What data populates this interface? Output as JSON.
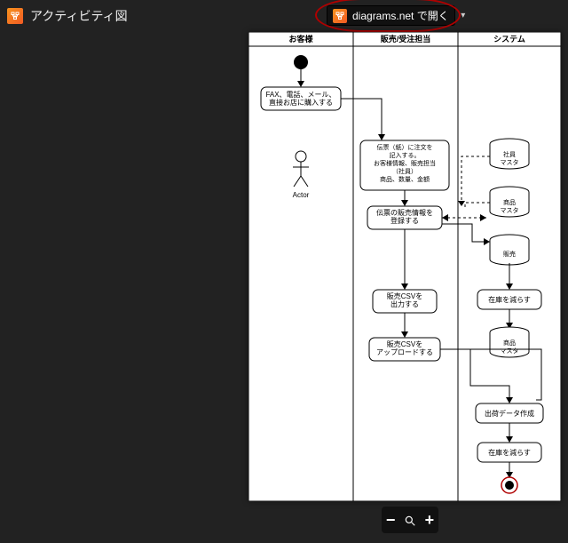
{
  "header": {
    "title": "アクティビティ図",
    "open_label": "diagrams.net で開く"
  },
  "zoom": {
    "minus": "−",
    "plus": "+"
  },
  "diagram": {
    "lanes": [
      "お客様",
      "販売/受注担当",
      "システム"
    ],
    "actor_label": "Actor",
    "nodes": {
      "customer_action": "FAX、電話、メール、\n直接お店に購入する",
      "fill_slip": "伝票（紙）に注文を\n記入する。\nお客様情報、販売担当\n（社員）\n商品、数量、金額",
      "register_sale": "伝票の販売情報を\n登録する",
      "export_csv": "販売CSVを\n出力する",
      "upload_csv": "販売CSVを\nアップロードする",
      "reduce_stock_1": "在庫を減らす",
      "create_ship": "出荷データ作成",
      "reduce_stock_2": "在庫を減らす",
      "db_staff": "社員\nマスタ",
      "db_product_1": "商品\nマスタ",
      "db_sales": "販売",
      "db_product_2": "商品\nマスタ"
    }
  }
}
